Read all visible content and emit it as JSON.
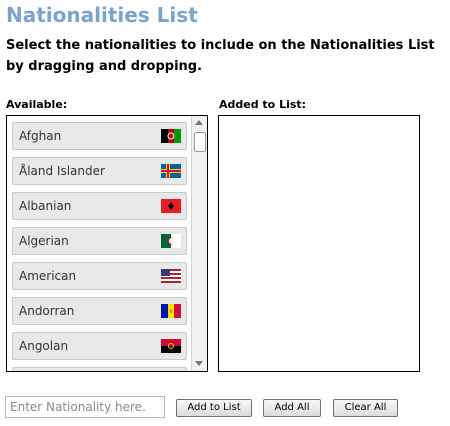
{
  "page": {
    "title": "Nationalities List",
    "instructions": "Select the nationalities to include on the Nationalities List by dragging and dropping."
  },
  "available": {
    "label": "Available:",
    "items": [
      {
        "label": "Afghan",
        "flag_icon": "afghanistan-flag-icon"
      },
      {
        "label": "Åland Islander",
        "flag_icon": "aland-islands-flag-icon"
      },
      {
        "label": "Albanian",
        "flag_icon": "albania-flag-icon"
      },
      {
        "label": "Algerian",
        "flag_icon": "algeria-flag-icon"
      },
      {
        "label": "American",
        "flag_icon": "united-states-flag-icon"
      },
      {
        "label": "Andorran",
        "flag_icon": "andorra-flag-icon"
      },
      {
        "label": "Angolan",
        "flag_icon": "angola-flag-icon"
      }
    ]
  },
  "added": {
    "label": "Added to List:",
    "items": []
  },
  "controls": {
    "input_placeholder": "Enter Nationality here.",
    "add_label": "Add to List",
    "add_all_label": "Add All",
    "clear_all_label": "Clear All"
  },
  "colors": {
    "title": "#7aa3cf",
    "item_background": "#e8e8e8"
  }
}
